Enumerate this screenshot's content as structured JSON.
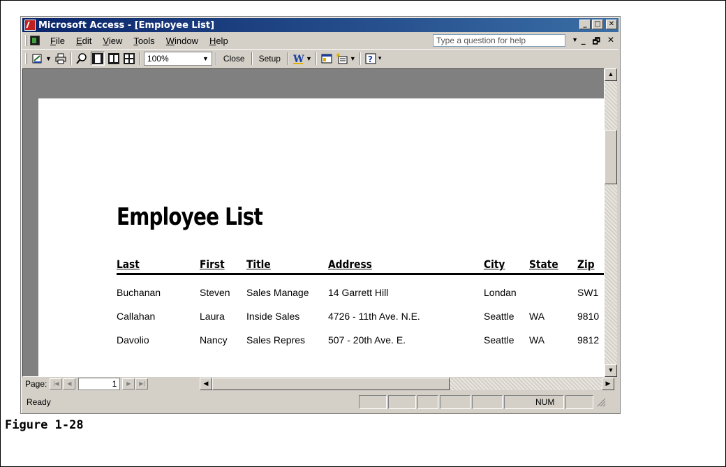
{
  "window": {
    "title": "Microsoft Access - [Employee List]",
    "title_buttons": [
      "_",
      "□",
      "✕"
    ]
  },
  "menu": {
    "items": [
      {
        "label": "File",
        "u": "F",
        "rest": "ile"
      },
      {
        "label": "Edit",
        "u": "E",
        "rest": "dit"
      },
      {
        "label": "View",
        "u": "V",
        "rest": "iew"
      },
      {
        "label": "Tools",
        "u": "T",
        "rest": "ools"
      },
      {
        "label": "Window",
        "u": "W",
        "rest": "indow"
      },
      {
        "label": "Help",
        "u": "H",
        "rest": "elp"
      }
    ],
    "help_placeholder": "Type a question for help",
    "mdi_buttons": [
      "_",
      "🗗",
      "✕"
    ]
  },
  "toolbar": {
    "zoom": "100%",
    "close_label": "Close",
    "setup_label": "Setup",
    "icons": [
      "view-icon",
      "print-icon",
      "zoom-icon",
      "one-page-icon",
      "two-pages-icon",
      "multiple-pages-icon",
      "word-icon",
      "database-window-icon",
      "new-object-icon",
      "help-icon"
    ]
  },
  "report": {
    "title": "Employee List",
    "columns": [
      "Last",
      "First",
      "Title",
      "Address",
      "City",
      "State",
      "Zip"
    ],
    "rows": [
      [
        "Buchanan",
        "Steven",
        "Sales Manage",
        "14 Garrett Hill",
        "Londan",
        "",
        "SW1"
      ],
      [
        "Callahan",
        "Laura",
        "Inside Sales",
        "4726 - 11th Ave. N.E.",
        "Seattle",
        "WA",
        "9810"
      ],
      [
        "Davolio",
        "Nancy",
        "Sales Repres",
        "507 - 20th Ave. E.",
        "Seattle",
        "WA",
        "9812"
      ]
    ]
  },
  "navigation": {
    "page_label": "Page:",
    "page_number": "1"
  },
  "status": {
    "text": "Ready",
    "num": "NUM"
  },
  "caption": "Figure 1-28"
}
